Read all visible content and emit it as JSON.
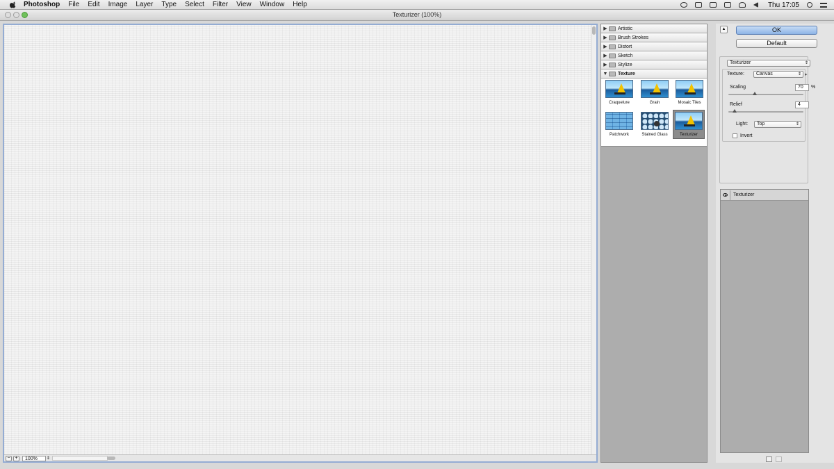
{
  "menubar": {
    "app_name": "Photoshop",
    "items": [
      "File",
      "Edit",
      "Image",
      "Layer",
      "Type",
      "Select",
      "Filter",
      "View",
      "Window",
      "Help"
    ],
    "clock": "Thu 17:05"
  },
  "window": {
    "title": "Texturizer (100%)"
  },
  "canvas": {
    "zoom": "100%"
  },
  "filters": {
    "categories": [
      {
        "label": "Artistic",
        "open": false
      },
      {
        "label": "Brush Strokes",
        "open": false
      },
      {
        "label": "Distort",
        "open": false
      },
      {
        "label": "Sketch",
        "open": false
      },
      {
        "label": "Stylize",
        "open": false
      },
      {
        "label": "Texture",
        "open": true
      }
    ],
    "thumbnails": [
      {
        "label": "Craquelure",
        "selected": false
      },
      {
        "label": "Grain",
        "selected": false
      },
      {
        "label": "Mosaic Tiles",
        "selected": false
      },
      {
        "label": "Patchwork",
        "selected": false
      },
      {
        "label": "Stained Glass",
        "selected": false
      },
      {
        "label": "Texturizer",
        "selected": true
      }
    ]
  },
  "settings": {
    "ok_label": "OK",
    "default_label": "Default",
    "filter_select": "Texturizer",
    "texture_label": "Texture:",
    "texture_value": "Canvas",
    "scaling_label": "Scaling",
    "scaling_value": "70",
    "scaling_unit": "%",
    "scaling_fraction": 0.35,
    "relief_label": "Relief",
    "relief_value": "4",
    "relief_fraction": 0.08,
    "light_label": "Light:",
    "light_value": "Top",
    "invert_label": "Invert",
    "invert_checked": false
  },
  "layers": {
    "items": [
      "Texturizer"
    ]
  },
  "colors": {
    "ok_button": "#8db4e6",
    "canvas_border": "#94acd3",
    "selected_thumb": "#8c8c8c"
  }
}
